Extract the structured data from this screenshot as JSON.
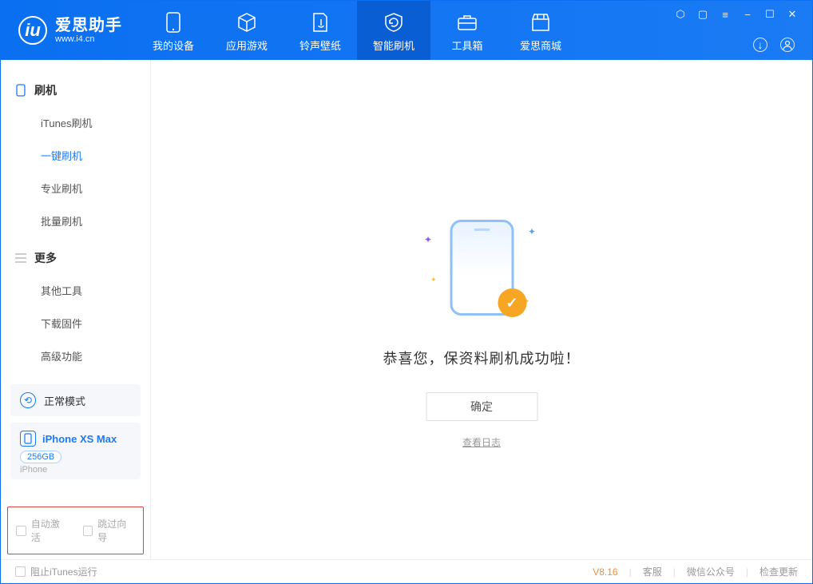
{
  "app": {
    "name": "爱思助手",
    "url": "www.i4.cn"
  },
  "nav": {
    "items": [
      {
        "label": "我的设备"
      },
      {
        "label": "应用游戏"
      },
      {
        "label": "铃声壁纸"
      },
      {
        "label": "智能刷机"
      },
      {
        "label": "工具箱"
      },
      {
        "label": "爱思商城"
      }
    ]
  },
  "sidebar": {
    "group1_title": "刷机",
    "group1_items": [
      "iTunes刷机",
      "一键刷机",
      "专业刷机",
      "批量刷机"
    ],
    "group2_title": "更多",
    "group2_items": [
      "其他工具",
      "下载固件",
      "高级功能"
    ],
    "mode_label": "正常模式",
    "device_name": "iPhone XS Max",
    "device_capacity": "256GB",
    "device_type": "iPhone",
    "opt_auto_activate": "自动激活",
    "opt_skip_guide": "跳过向导"
  },
  "main": {
    "message": "恭喜您，保资料刷机成功啦！",
    "ok_button": "确定",
    "log_link": "查看日志"
  },
  "footer": {
    "stop_itunes": "阻止iTunes运行",
    "version": "V8.16",
    "service": "客服",
    "wechat": "微信公众号",
    "check_update": "检查更新"
  }
}
